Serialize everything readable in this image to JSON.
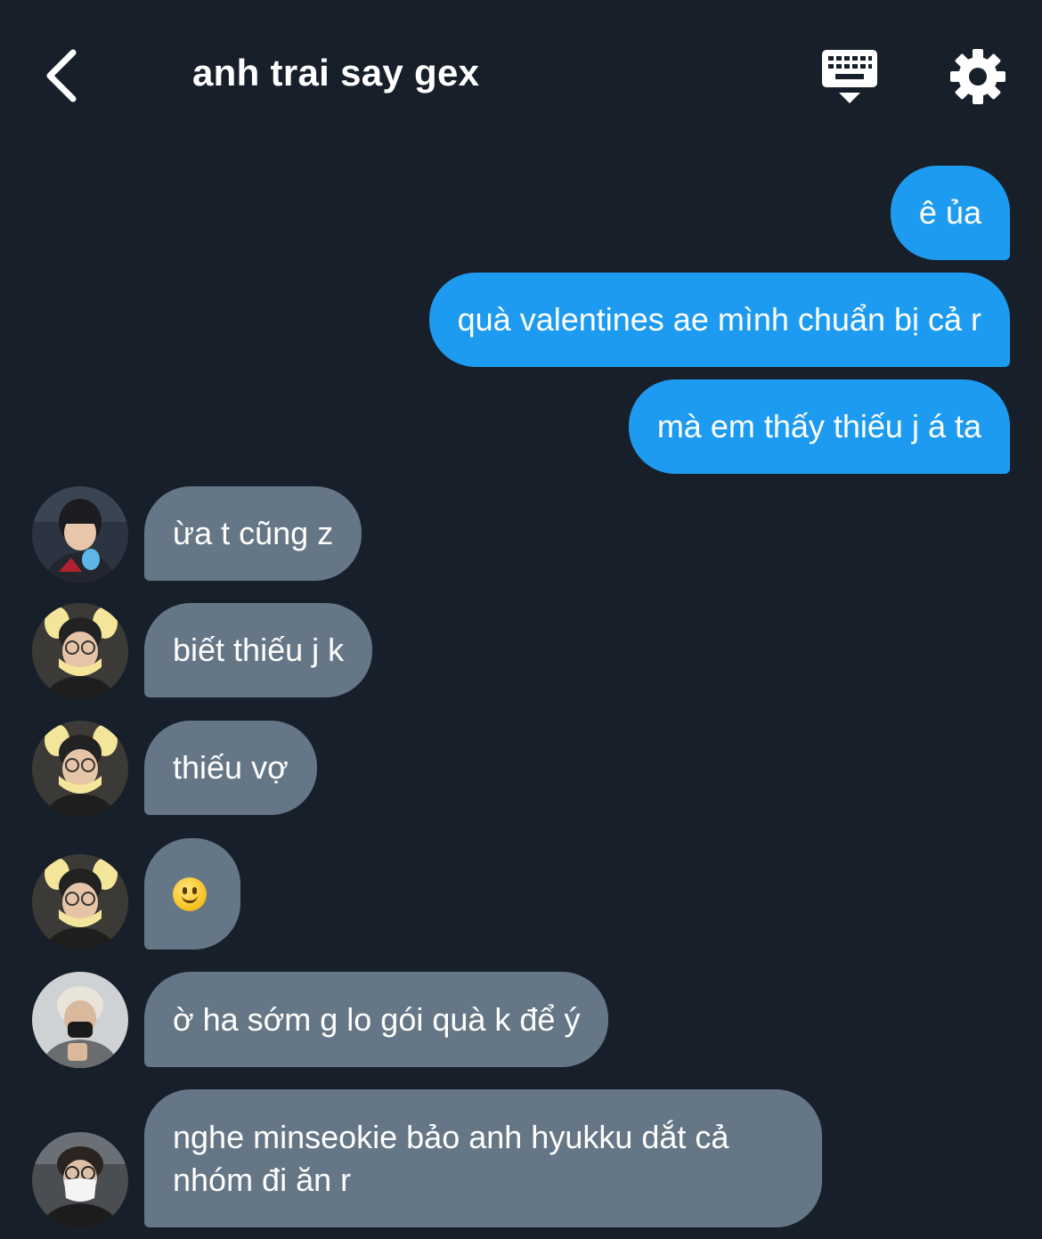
{
  "header": {
    "title": "anh trai say gex",
    "back_icon": "chevron-left-icon",
    "keyboard_icon": "keyboard-icon",
    "settings_icon": "gear-icon"
  },
  "messages": [
    {
      "direction": "out",
      "text": "ê ủa"
    },
    {
      "direction": "out",
      "text": "quà valentines ae mình chuẩn bị cả r"
    },
    {
      "direction": "out",
      "text": "mà em thấy thiếu j á ta"
    },
    {
      "direction": "in",
      "text": "ừa t cũng z",
      "avatar": "avatar-1"
    },
    {
      "direction": "in",
      "text": "biết thiếu j k",
      "avatar": "avatar-2"
    },
    {
      "direction": "in",
      "text": "thiếu vợ",
      "avatar": "avatar-2"
    },
    {
      "direction": "in",
      "text": "",
      "emoji": "slightly-smiling-face-emoji",
      "avatar": "avatar-2"
    },
    {
      "direction": "in",
      "text": "ờ ha sớm g lo gói quà k để ý",
      "avatar": "avatar-3"
    },
    {
      "direction": "in",
      "text": "nghe minseokie bảo anh hyukku dắt cả nhóm đi ăn r",
      "avatar": "avatar-4"
    }
  ],
  "colors": {
    "background": "#17202a",
    "outgoing_bubble": "#1d9bf0",
    "incoming_bubble": "#657786",
    "text": "#ffffff"
  }
}
